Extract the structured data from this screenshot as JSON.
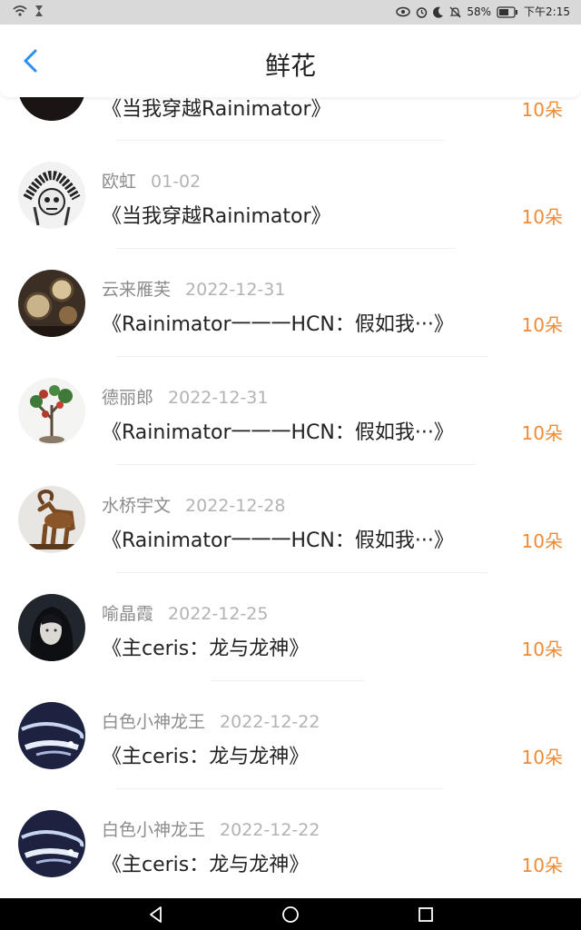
{
  "statusbar": {
    "battery": "58%",
    "time": "下午2:15"
  },
  "header": {
    "title": "鲜花"
  },
  "items": [
    {
      "name": "",
      "date": "",
      "book": "《当我穿越Rainimator》",
      "count": "10朵"
    },
    {
      "name": "欧虹",
      "date": "01-02",
      "book": "《当我穿越Rainimator》",
      "count": "10朵"
    },
    {
      "name": "云来雁芙",
      "date": "2022-12-31",
      "book": "《Rainimator一一一HCN：假如我···》",
      "count": "10朵"
    },
    {
      "name": "德丽郎",
      "date": "2022-12-31",
      "book": "《Rainimator一一一HCN：假如我···》",
      "count": "10朵"
    },
    {
      "name": "水桥宇文",
      "date": "2022-12-28",
      "book": "《Rainimator一一一HCN：假如我···》",
      "count": "10朵"
    },
    {
      "name": "喻晶霞",
      "date": "2022-12-25",
      "book": "《主ceris：龙与龙神》",
      "count": "10朵"
    },
    {
      "name": "白色小神龙王",
      "date": "2022-12-22",
      "book": "《主ceris：龙与龙神》",
      "count": "10朵"
    },
    {
      "name": "白色小神龙王",
      "date": "2022-12-22",
      "book": "《主ceris：龙与龙神》",
      "count": "10朵"
    }
  ],
  "colors": {
    "accent": "#f08a35",
    "back_arrow": "#2b8ef0",
    "statusbar": "#d9d9d9",
    "navbar": "#000000"
  }
}
